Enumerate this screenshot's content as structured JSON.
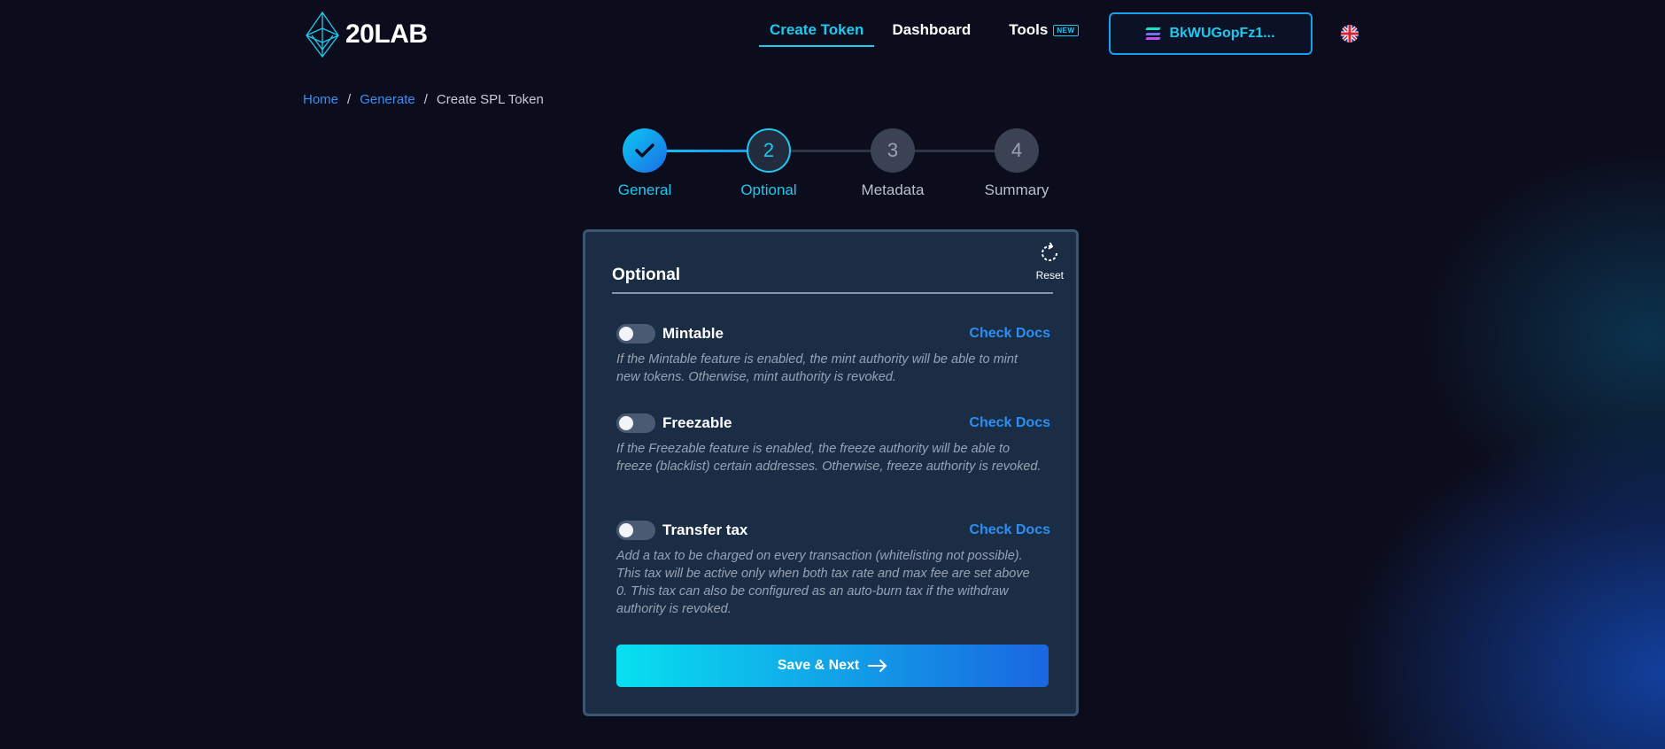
{
  "brand": {
    "name": "20LAB"
  },
  "nav": {
    "create_token": "Create Token",
    "dashboard": "Dashboard",
    "tools": "Tools",
    "tools_badge": "NEW",
    "wallet_address": "BkWUGopFz1..."
  },
  "breadcrumb": {
    "home": "Home",
    "generate": "Generate",
    "current": "Create SPL Token",
    "sep": "/"
  },
  "stepper": {
    "steps": [
      {
        "number": "1",
        "label": "General",
        "state": "done"
      },
      {
        "number": "2",
        "label": "Optional",
        "state": "current"
      },
      {
        "number": "3",
        "label": "Metadata",
        "state": "upcoming"
      },
      {
        "number": "4",
        "label": "Summary",
        "state": "upcoming"
      }
    ]
  },
  "card": {
    "title": "Optional",
    "reset_label": "Reset",
    "options": [
      {
        "name": "Mintable",
        "docs_label": "Check Docs",
        "enabled": false,
        "description": "If the Mintable feature is enabled, the mint authority will be able to mint new tokens. Otherwise, mint authority is revoked."
      },
      {
        "name": "Freezable",
        "docs_label": "Check Docs",
        "enabled": false,
        "description": "If the Freezable feature is enabled, the freeze authority will be able to freeze (blacklist) certain addresses. Otherwise, freeze authority is revoked."
      },
      {
        "name": "Transfer tax",
        "docs_label": "Check Docs",
        "enabled": false,
        "description": "Add a tax to be charged on every transaction (whitelisting not possible). This tax will be active only when both tax rate and max fee are set above 0. This tax can also be configured as an auto-burn tax if the withdraw authority is revoked."
      }
    ],
    "save_label": "Save & Next"
  },
  "colors": {
    "accent": "#1ec9f0",
    "link": "#2b8ff5",
    "background": "#0c0d1c",
    "card": "#1a2d44"
  }
}
